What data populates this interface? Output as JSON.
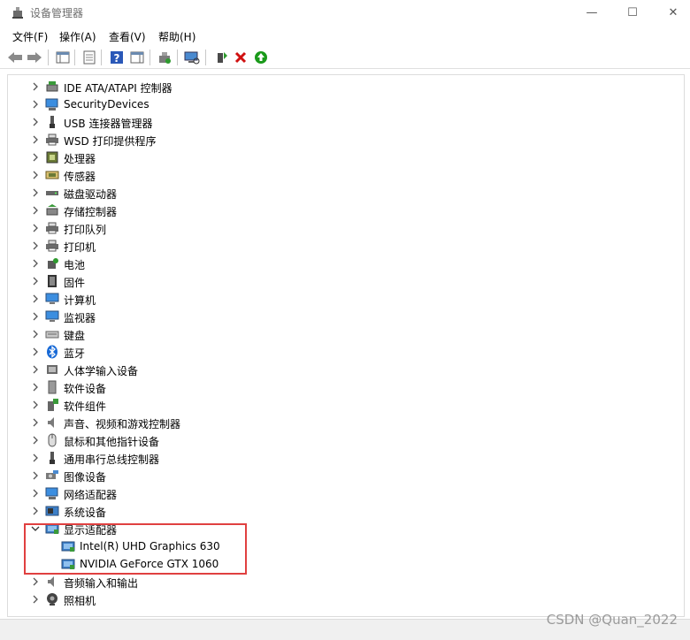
{
  "window": {
    "title": "设备管理器",
    "controls": {
      "minimize": "—",
      "maximize": "☐",
      "close": "✕"
    }
  },
  "menu": [
    "文件(F)",
    "操作(A)",
    "查看(V)",
    "帮助(H)"
  ],
  "tree": {
    "categories": [
      {
        "label": "IDE ATA/ATAPI 控制器",
        "icon": "ide-controller-icon",
        "expanded": false
      },
      {
        "label": "SecurityDevices",
        "icon": "security-devices-icon",
        "expanded": false
      },
      {
        "label": "USB 连接器管理器",
        "icon": "usb-icon",
        "expanded": false
      },
      {
        "label": "WSD 打印提供程序",
        "icon": "printer-icon",
        "expanded": false
      },
      {
        "label": "处理器",
        "icon": "processor-icon",
        "expanded": false
      },
      {
        "label": "传感器",
        "icon": "sensor-icon",
        "expanded": false
      },
      {
        "label": "磁盘驱动器",
        "icon": "disk-drive-icon",
        "expanded": false
      },
      {
        "label": "存储控制器",
        "icon": "storage-controller-icon",
        "expanded": false
      },
      {
        "label": "打印队列",
        "icon": "print-queue-icon",
        "expanded": false
      },
      {
        "label": "打印机",
        "icon": "printer-icon",
        "expanded": false
      },
      {
        "label": "电池",
        "icon": "battery-icon",
        "expanded": false
      },
      {
        "label": "固件",
        "icon": "firmware-icon",
        "expanded": false
      },
      {
        "label": "计算机",
        "icon": "computer-icon",
        "expanded": false
      },
      {
        "label": "监视器",
        "icon": "monitor-icon",
        "expanded": false
      },
      {
        "label": "键盘",
        "icon": "keyboard-icon",
        "expanded": false
      },
      {
        "label": "蓝牙",
        "icon": "bluetooth-icon",
        "expanded": false
      },
      {
        "label": "人体学输入设备",
        "icon": "hid-icon",
        "expanded": false
      },
      {
        "label": "软件设备",
        "icon": "software-device-icon",
        "expanded": false
      },
      {
        "label": "软件组件",
        "icon": "software-component-icon",
        "expanded": false
      },
      {
        "label": "声音、视频和游戏控制器",
        "icon": "speaker-icon",
        "expanded": false
      },
      {
        "label": "鼠标和其他指针设备",
        "icon": "mouse-icon",
        "expanded": false
      },
      {
        "label": "通用串行总线控制器",
        "icon": "usb-controller-icon",
        "expanded": false
      },
      {
        "label": "图像设备",
        "icon": "camera-icon",
        "expanded": false
      },
      {
        "label": "网络适配器",
        "icon": "network-adapter-icon",
        "expanded": false
      },
      {
        "label": "系统设备",
        "icon": "system-device-icon",
        "expanded": false
      },
      {
        "label": "显示适配器",
        "icon": "display-adapter-icon",
        "expanded": true
      },
      {
        "label": "Intel(R) UHD Graphics 630",
        "icon": "display-adapter-icon",
        "child": true
      },
      {
        "label": "NVIDIA GeForce GTX 1060",
        "icon": "display-adapter-icon",
        "child": true
      },
      {
        "label": "音频输入和输出",
        "icon": "audio-io-icon",
        "expanded": false
      },
      {
        "label": "照相机",
        "icon": "webcam-icon",
        "expanded": false
      }
    ]
  },
  "watermark": "CSDN @Quan_2022",
  "colors": {
    "highlight_border": "#e04040",
    "selected_bg": "#cce8ff",
    "green_arrow": "#1a9a1a",
    "red_x": "#d01010"
  }
}
